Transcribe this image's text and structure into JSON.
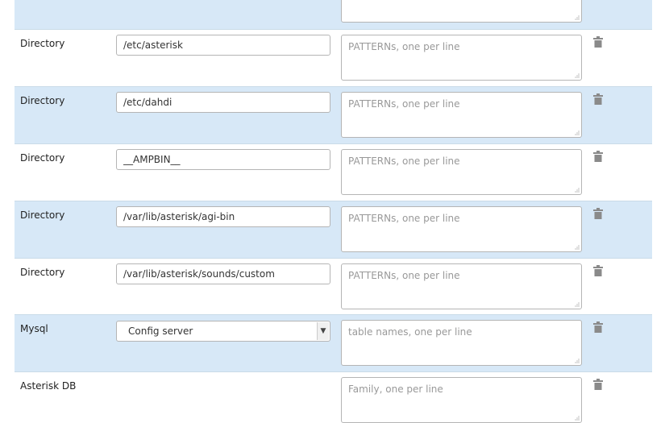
{
  "rows": [
    {
      "type": "",
      "value": "",
      "placeholder": "",
      "shade": "blue"
    },
    {
      "type": "Directory",
      "value": "/etc/asterisk",
      "placeholder": "PATTERNs, one per line",
      "shade": "white"
    },
    {
      "type": "Directory",
      "value": "/etc/dahdi",
      "placeholder": "PATTERNs, one per line",
      "shade": "blue"
    },
    {
      "type": "Directory",
      "value": "__AMPBIN__",
      "placeholder": "PATTERNs, one per line",
      "shade": "white"
    },
    {
      "type": "Directory",
      "value": "/var/lib/asterisk/agi-bin",
      "placeholder": "PATTERNs, one per line",
      "shade": "blue"
    },
    {
      "type": "Directory",
      "value": "/var/lib/asterisk/sounds/custom",
      "placeholder": "PATTERNs, one per line",
      "shade": "white"
    },
    {
      "type": "Mysql",
      "select_value": "Config server",
      "placeholder": "table names, one per line",
      "shade": "blue"
    },
    {
      "type": "Asterisk DB",
      "placeholder": "Family, one per line",
      "shade": "white"
    }
  ],
  "colors": {
    "row_blue": "#d7e8f7",
    "row_white": "#ffffff",
    "trash": "#8a8a8a"
  },
  "icons": {
    "delete": "trash-icon",
    "select": "chevron-down-icon"
  }
}
